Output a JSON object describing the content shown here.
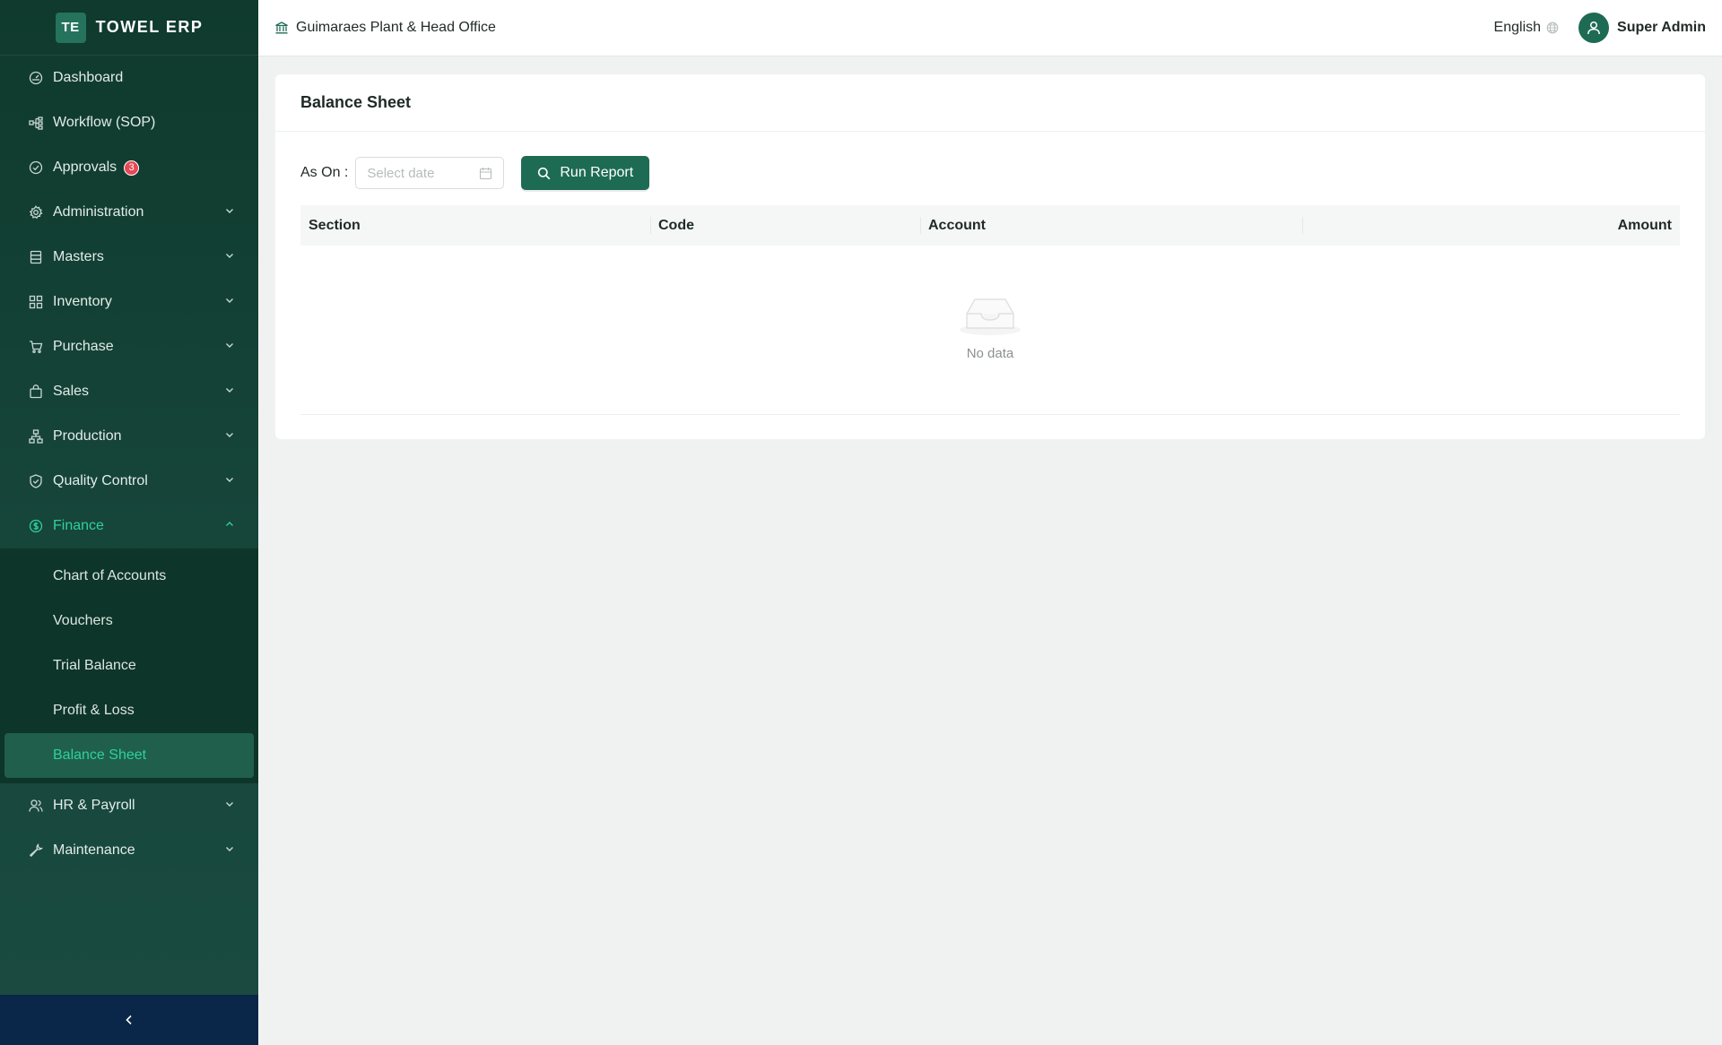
{
  "brand": {
    "logo_text": "TE",
    "name": "TOWEL ERP"
  },
  "sidebar": {
    "items": [
      {
        "label": "Dashboard",
        "icon": "dashboard-icon"
      },
      {
        "label": "Workflow (SOP)",
        "icon": "workflow-icon"
      },
      {
        "label": "Approvals",
        "icon": "check-circle-icon",
        "badge": "3"
      },
      {
        "label": "Administration",
        "icon": "gear-icon"
      },
      {
        "label": "Masters",
        "icon": "database-icon"
      },
      {
        "label": "Inventory",
        "icon": "grid-icon"
      },
      {
        "label": "Purchase",
        "icon": "cart-icon"
      },
      {
        "label": "Sales",
        "icon": "bag-icon"
      },
      {
        "label": "Production",
        "icon": "cluster-icon"
      },
      {
        "label": "Quality Control",
        "icon": "shield-check-icon"
      },
      {
        "label": "Finance",
        "icon": "dollar-circle-icon"
      },
      {
        "label": "HR & Payroll",
        "icon": "users-icon"
      },
      {
        "label": "Maintenance",
        "icon": "wrench-icon"
      }
    ],
    "finance_sub": [
      {
        "label": "Chart of Accounts"
      },
      {
        "label": "Vouchers"
      },
      {
        "label": "Trial Balance"
      },
      {
        "label": "Profit & Loss"
      },
      {
        "label": "Balance Sheet"
      }
    ]
  },
  "header": {
    "org_name": "Guimaraes Plant & Head Office",
    "language": "English",
    "user_name": "Super Admin"
  },
  "main": {
    "title": "Balance Sheet",
    "as_on_label": "As On :",
    "date_placeholder": "Select date",
    "run_button": "Run Report",
    "table": {
      "columns": [
        "Section",
        "Code",
        "Account",
        "Amount"
      ]
    },
    "empty_text": "No data"
  },
  "colors": {
    "primary": "#1e6b54",
    "active_green": "#2fd19a",
    "badge_red": "#e84855",
    "collapse_bar": "#0a2648"
  }
}
